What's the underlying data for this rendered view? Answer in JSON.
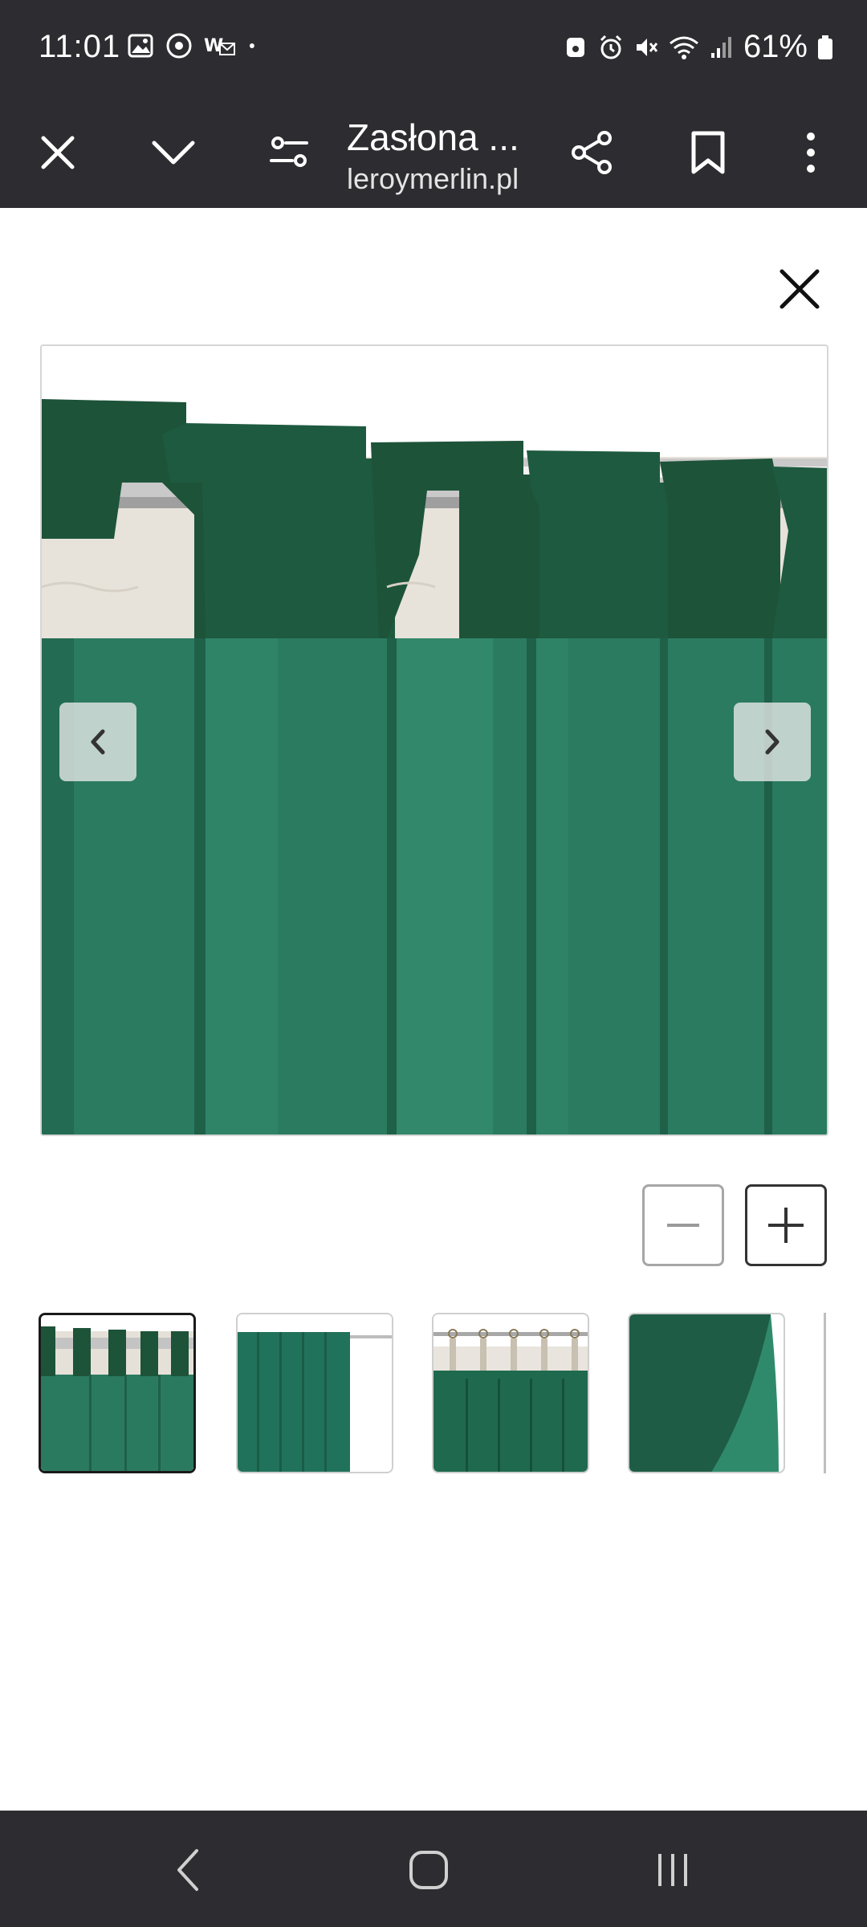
{
  "status_bar": {
    "time": "11:01",
    "battery_percent": "61%",
    "left_icons": [
      "gallery-icon",
      "chrome-icon",
      "vpn-mail-icon",
      "dot-icon"
    ],
    "right_icons": [
      "lock-icon",
      "alarm-icon",
      "mute-icon",
      "wifi-icon",
      "signal-icon",
      "battery-icon"
    ]
  },
  "browser_toolbar": {
    "page_title": "Zasłona ...",
    "domain": "leroymerlin.pl",
    "icons": [
      "close-icon",
      "chevron-down-icon",
      "settings-sliders-icon",
      "share-icon",
      "bookmark-icon",
      "more-vertical-icon"
    ]
  },
  "gallery": {
    "selected_index": 0,
    "total_visible_thumbnails": 4,
    "colors": {
      "curtain_green": "#2a7a60",
      "curtain_dark_green": "#1f5c45",
      "tab_green": "#1d5339",
      "lining_cream": "#e6e1d8",
      "rod_silver": "#b9b9b9"
    }
  },
  "system_nav": {
    "icons": [
      "back-icon",
      "home-icon",
      "recents-icon"
    ]
  }
}
